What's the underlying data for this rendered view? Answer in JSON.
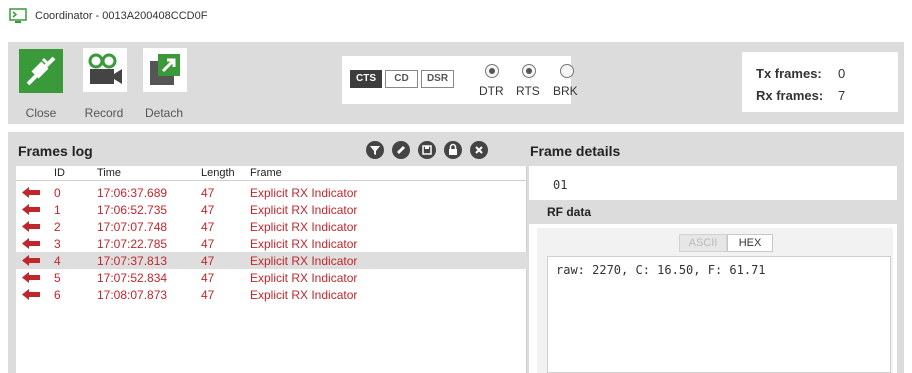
{
  "window": {
    "title": "Coordinator - 0013A200408CCD0F"
  },
  "toolbar": {
    "buttons": [
      {
        "label": "Close",
        "icon": "connect-plug-icon"
      },
      {
        "label": "Record",
        "icon": "camera-icon"
      },
      {
        "label": "Detach",
        "icon": "detach-window-icon"
      }
    ]
  },
  "serial_lines": {
    "cts": "CTS",
    "cd": "CD",
    "dsr": "DSR",
    "dtr": "DTR",
    "rts": "RTS",
    "brk": "BRK"
  },
  "counters": {
    "tx_label": "Tx frames:",
    "tx_value": "0",
    "rx_label": "Rx frames:",
    "rx_value": "7"
  },
  "frames_log": {
    "title": "Frames log",
    "actions": [
      "filter-icon",
      "clear-icon",
      "save-icon",
      "lock-icon",
      "close-icon"
    ],
    "columns": {
      "id": "ID",
      "time": "Time",
      "length": "Length",
      "frame": "Frame"
    },
    "rows": [
      {
        "id": "0",
        "time": "17:06:37.689",
        "length": "47",
        "frame": "Explicit RX Indicator"
      },
      {
        "id": "1",
        "time": "17:06:52.735",
        "length": "47",
        "frame": "Explicit RX Indicator"
      },
      {
        "id": "2",
        "time": "17:07:07.748",
        "length": "47",
        "frame": "Explicit RX Indicator"
      },
      {
        "id": "3",
        "time": "17:07:22.785",
        "length": "47",
        "frame": "Explicit RX Indicator"
      },
      {
        "id": "4",
        "time": "17:07:37.813",
        "length": "47",
        "frame": "Explicit RX Indicator"
      },
      {
        "id": "5",
        "time": "17:07:52.834",
        "length": "47",
        "frame": "Explicit RX Indicator"
      },
      {
        "id": "6",
        "time": "17:08:07.873",
        "length": "47",
        "frame": "Explicit RX Indicator"
      }
    ],
    "selected_index": 4
  },
  "frame_details": {
    "title": "Frame details",
    "value": "01",
    "rf_title": "RF data",
    "tabs": {
      "ascii": "ASCII",
      "hex": "HEX"
    },
    "rf_content": "raw: 2270, C: 16.50, F: 61.71"
  },
  "colors": {
    "accent_green": "#3a9a3a",
    "frame_red": "#c0272d",
    "panel_gray": "#dcdcdc"
  }
}
